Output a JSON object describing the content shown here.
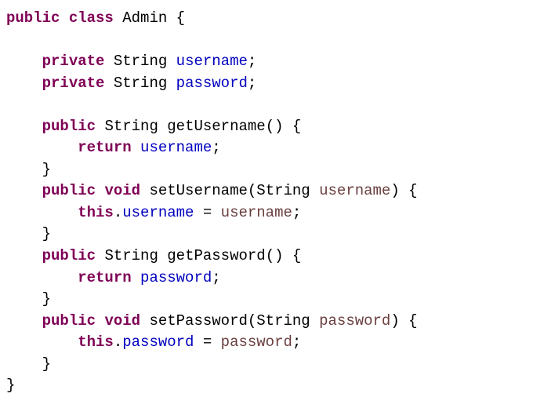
{
  "tokens": {
    "kw_public": "public",
    "kw_class": "class",
    "kw_private": "private",
    "kw_void": "void",
    "kw_return": "return",
    "kw_this": "this",
    "type_string": "String",
    "class_name": "Admin",
    "field_username": "username",
    "field_password": "password",
    "method_getUsername": "getUsername",
    "method_setUsername": "setUsername",
    "method_getPassword": "getPassword",
    "method_setPassword": "setPassword",
    "param_username": "username",
    "param_password": "password",
    "lbrace": "{",
    "rbrace": "}",
    "lparen": "(",
    "rparen": ")",
    "semi": ";",
    "dot": ".",
    "assign": " = "
  },
  "indent1": "    ",
  "indent2": "        ",
  "sp": " "
}
